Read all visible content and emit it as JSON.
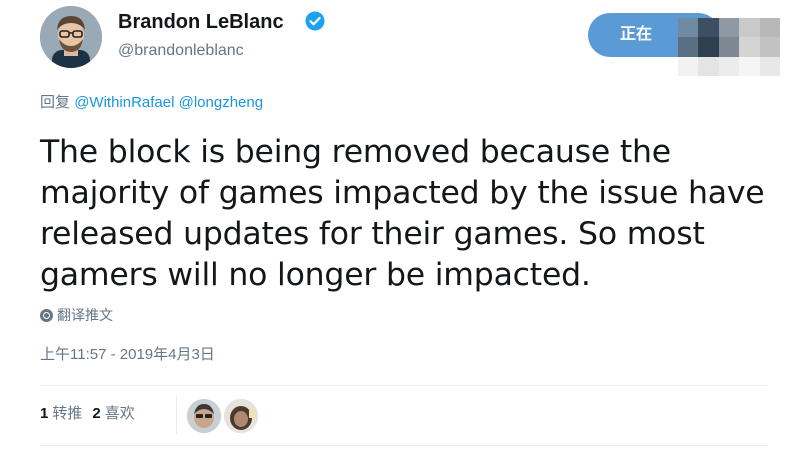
{
  "author": {
    "display_name": "Brandon LeBlanc",
    "handle": "@brandonleblanc",
    "verified": true
  },
  "follow_button": {
    "label": "正在"
  },
  "reply": {
    "prefix": "回复",
    "mentions": [
      "@WithinRafael",
      "@longzheng"
    ]
  },
  "tweet": {
    "lines": [
      "The block is being removed because the",
      "majority of games impacted by the issue have",
      "released updates for their games. So most",
      "gamers will no longer be impacted."
    ]
  },
  "translate_label": "翻译推文",
  "timestamp": "上午11:57 - 2019年4月3日",
  "stats": {
    "retweets_count": "1",
    "retweets_label": "转推",
    "likes_count": "2",
    "likes_label": "喜欢"
  },
  "colors": {
    "link": "#1b95e0",
    "muted": "#657786",
    "button": "#5b9bd5",
    "verified": "#1da1f2"
  },
  "icons": {
    "verified": "verified-badge-icon",
    "translate": "globe-icon"
  }
}
